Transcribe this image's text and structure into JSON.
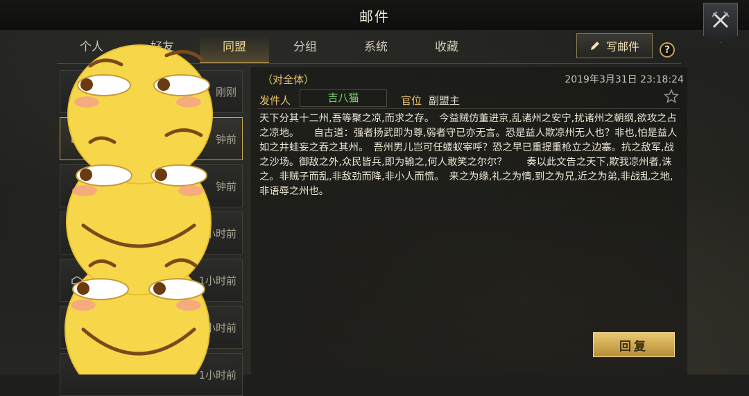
{
  "window": {
    "title": "邮件"
  },
  "tabs": [
    {
      "label": "个人"
    },
    {
      "label": "好友"
    },
    {
      "label": "同盟"
    },
    {
      "label": "分组"
    },
    {
      "label": "系统"
    },
    {
      "label": "收藏"
    }
  ],
  "active_tab": "同盟",
  "toolbar": {
    "write_label": "写邮件",
    "help_label": "?"
  },
  "mail_list": [
    {
      "time": "刚刚"
    },
    {
      "time": "钟前"
    },
    {
      "time": "钟前"
    },
    {
      "time": "小时前"
    },
    {
      "time": "1小时前"
    },
    {
      "time": "小时前"
    },
    {
      "time": "1小时前"
    }
  ],
  "mail": {
    "recipient": "（对全体）",
    "date": "2019年3月31日 23:18:24",
    "sender_label": "发件人",
    "sender_name": "吉八猫",
    "rank_label": "官位",
    "rank_value": "副盟主",
    "body": "天下分其十二州,吾等聚之凉,而求之存。　今益贼仿董进京,乱诸州之安宁,扰诸州之朝纲,欲攻之占之凉地。　　自古道：强者扬武即为尊,弱者守已亦无言。恐是益人欺凉州无人也？非也,怕是益人如之井蛙妄之吞之其州。　吾州男儿岂可任蝼蚁宰呼？恐之早已重提重枪立之边塞。抗之敌军,战之沙场。御敌之外,众民皆兵,即为输之,何人敢笑之尔尔？　　奏以此文告之天下,欺我凉州者,诛之。非贼子而乱,非敌劲而降,非小人而慌。　来之为缘,礼之为情,到之为兄,近之为弟,非战乱之地,非语辱之州也。"
  },
  "reply_label": "回复",
  "colors": {
    "accent": "#c9a552",
    "sender": "#7bd86a",
    "label": "#e8c36a"
  }
}
